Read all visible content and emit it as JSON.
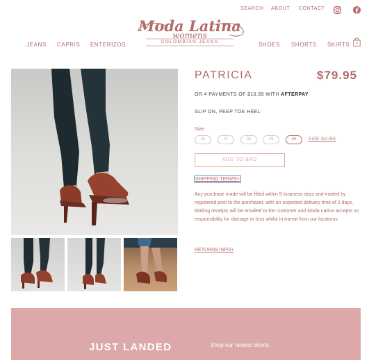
{
  "header": {
    "top_links": [
      "SEARCH",
      "ABOUT",
      "CONTACT"
    ],
    "nav_left": [
      "JEANS",
      "CAPRIS",
      "ENTERIZOS"
    ],
    "nav_right": [
      "SHOES",
      "SHORTS",
      "SKIRTS"
    ],
    "cart_count": "0",
    "logo": {
      "line1": "Moda Latina",
      "line2": "womens",
      "line3": "COLOMBIAN JEANS"
    }
  },
  "product": {
    "title": "PATRICIA",
    "price": "$79.95",
    "afterpay_text": "OR 4 PAYMENTS OF $19.99 WITH",
    "afterpay_brand": "AFTERPAY",
    "subtitle": "SLIP ON, PEEP TOE HEEL",
    "size_label": "Size",
    "sizes": [
      "36",
      "37",
      "38",
      "39",
      "40"
    ],
    "selected_size": "40",
    "size_guide": "SIZE GUIDE",
    "add_to_bag": "ADD TO BAG",
    "shipping_terms": "SHIPPING TERMS+",
    "shipping_desc": "Any purchase made will be filled within 5 business days and mailed by registered post to the purchaser, with an expected delivery time of 3 days. Mailing receipts will be emailed to the customer and Moda Latina accepts no responsibility for damage or loss whilst in transit from our locations.",
    "returns_info": "RETURNS INFO+"
  },
  "banner": {
    "heading": "JUST LANDED",
    "subtext": "Shop our newest shorts"
  },
  "colors": {
    "accent": "#b46a6a",
    "banner_bg": "#dca8a9"
  }
}
